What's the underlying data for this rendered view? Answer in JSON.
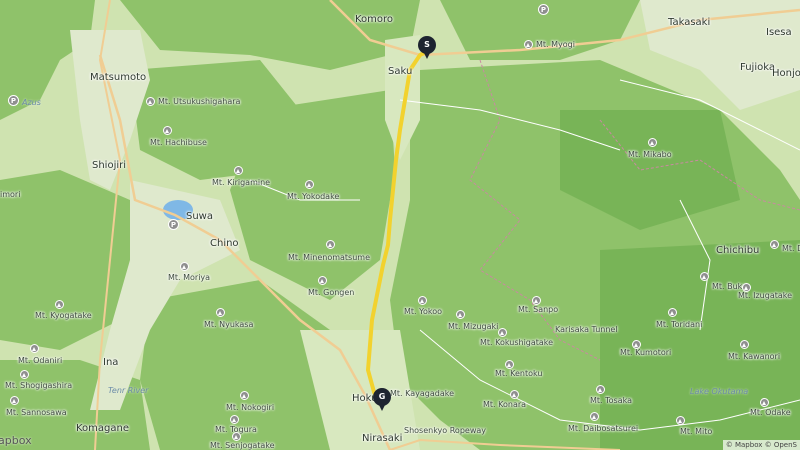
{
  "colors": {
    "terrain": "#cfe3b0",
    "forest": "#8fc26a",
    "forest_dark": "#78b457",
    "route": "#f2d22e",
    "road_major": "#f0cd93",
    "road_minor": "#ffffff",
    "water": "#7fb8e6",
    "marker": "#1d2430",
    "boundary": "#c98aa0"
  },
  "markers": {
    "start": {
      "label": "S"
    },
    "goal": {
      "label": "G"
    }
  },
  "cities": [
    {
      "name": "Komoro"
    },
    {
      "name": "Saku"
    },
    {
      "name": "Takasaki"
    },
    {
      "name": "Isesa"
    },
    {
      "name": "Fujioka"
    },
    {
      "name": "Honjo"
    },
    {
      "name": "Matsumoto"
    },
    {
      "name": "Shiojiri"
    },
    {
      "name": "Suwa"
    },
    {
      "name": "Chino"
    },
    {
      "name": "Ina"
    },
    {
      "name": "Komagane"
    },
    {
      "name": "Hokuto"
    },
    {
      "name": "Nirasaki"
    },
    {
      "name": "Chichibu"
    }
  ],
  "peaks": [
    {
      "name": "Mt. Myogi"
    },
    {
      "name": "Mt. Utsukushigahara"
    },
    {
      "name": "Mt. Hachibuse"
    },
    {
      "name": "Mt. Kirigamine"
    },
    {
      "name": "Mt. Yokodake"
    },
    {
      "name": "Mt. Mikabo"
    },
    {
      "name": "Mt. Minenomatsume"
    },
    {
      "name": "Mt. Gongen"
    },
    {
      "name": "Mt. Moriya"
    },
    {
      "name": "Mt. Kyogatake"
    },
    {
      "name": "Mt. Nyukasa"
    },
    {
      "name": "Mt. Odaniri"
    },
    {
      "name": "Mt. Shogigashira"
    },
    {
      "name": "Mt. Sannosawa"
    },
    {
      "name": "Mt. Nokogiri"
    },
    {
      "name": "Mt. Togura"
    },
    {
      "name": "Mt. Senjogatake"
    },
    {
      "name": "Mt. Yokoo"
    },
    {
      "name": "Mt. Mizugaki"
    },
    {
      "name": "Mt. Sanpo"
    },
    {
      "name": "Mt. Kokushigatake"
    },
    {
      "name": "Mt. Kentoku"
    },
    {
      "name": "Mt. Kayagadake"
    },
    {
      "name": "Mt. Konara"
    },
    {
      "name": "Mt. Buko"
    },
    {
      "name": "Mt. Izugatake"
    },
    {
      "name": "Mt. Toridani"
    },
    {
      "name": "Mt. Kumotori"
    },
    {
      "name": "Mt. Kawanori"
    },
    {
      "name": "Mt. Tosaka"
    },
    {
      "name": "Mt. Daibosatsurei"
    },
    {
      "name": "Mt. Mito"
    },
    {
      "name": "Mt. Odake"
    },
    {
      "name": "Mt. Dod"
    }
  ],
  "other_labels": [
    {
      "name": "Karisaka Tunnel"
    },
    {
      "name": "Shosenkyo Ropeway"
    },
    {
      "name": "imori"
    },
    {
      "name": "Azus"
    },
    {
      "name": "Tenr River"
    },
    {
      "name": "Lake Okutama"
    }
  ],
  "logo": "apbox",
  "attribution": "© Mapbox © OpenS"
}
